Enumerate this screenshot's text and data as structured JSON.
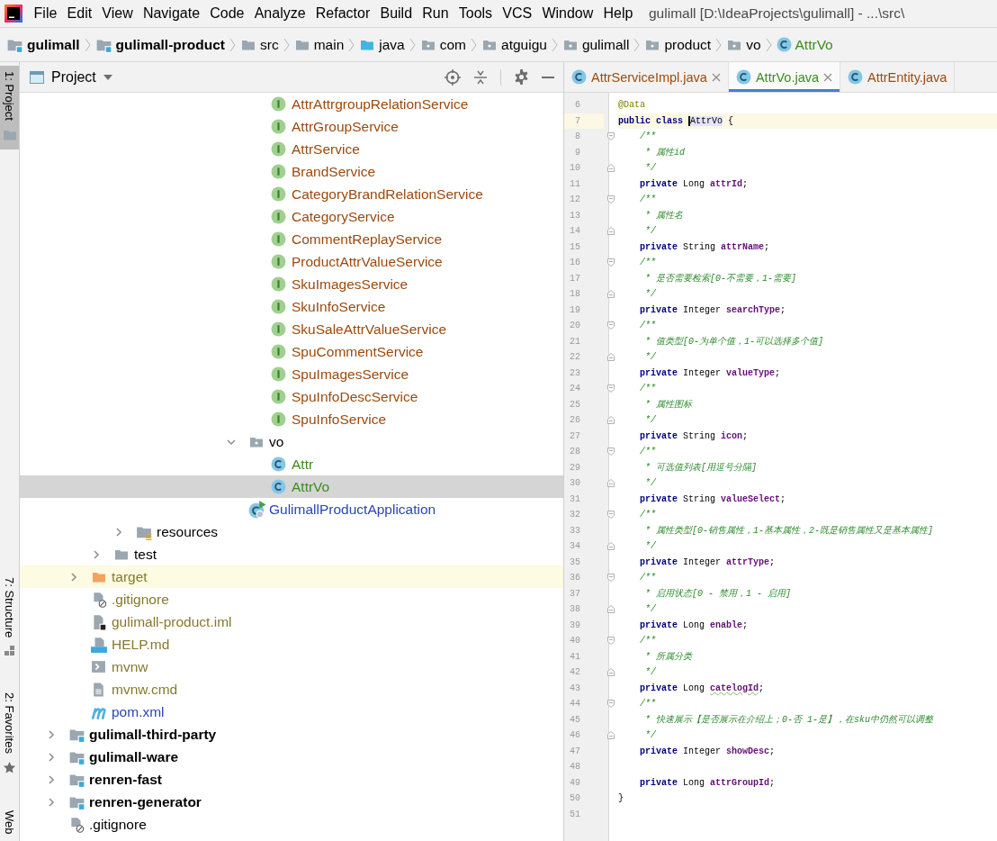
{
  "menu": {
    "items": [
      "File",
      "Edit",
      "View",
      "Navigate",
      "Code",
      "Analyze",
      "Refactor",
      "Build",
      "Run",
      "Tools",
      "VCS",
      "Window",
      "Help"
    ],
    "title": "gulimall [D:\\IdeaProjects\\gulimall] - ...\\src\\"
  },
  "breadcrumbs": [
    {
      "label": "gulimall",
      "kind": "module",
      "color": "#000000"
    },
    {
      "label": "gulimall-product",
      "kind": "module",
      "color": "#000000"
    },
    {
      "label": "src",
      "kind": "folder",
      "color": "#000000"
    },
    {
      "label": "main",
      "kind": "folder",
      "color": "#000000"
    },
    {
      "label": "java",
      "kind": "source-folder",
      "color": "#000000"
    },
    {
      "label": "com",
      "kind": "package",
      "color": "#000000"
    },
    {
      "label": "atguigu",
      "kind": "package",
      "color": "#000000"
    },
    {
      "label": "gulimall",
      "kind": "package",
      "color": "#000000"
    },
    {
      "label": "product",
      "kind": "package",
      "color": "#000000"
    },
    {
      "label": "vo",
      "kind": "package",
      "color": "#000000"
    },
    {
      "label": "AttrVo",
      "kind": "class",
      "color": "#3a8d1c"
    }
  ],
  "tool_strip": {
    "top": [
      {
        "label": "1: Project",
        "kind": "folder",
        "selected": true
      }
    ],
    "bottom": [
      {
        "label": "7: Structure",
        "kind": "structure",
        "selected": false
      },
      {
        "label": "2: Favorites",
        "kind": "star",
        "selected": false
      },
      {
        "label": "Web",
        "kind": "none",
        "selected": false
      }
    ]
  },
  "project": {
    "title": "Project",
    "tree": [
      {
        "children": [
          {
            "children": [
              {
                "children": [
                  {
                    "children": [
                      {
                        "children": [
                          {
                            "children": [
                              {
                                "children": [
                                  {
                                    "children": [
                                      {
                                        "children": [
                                          {
                                            "label": "AttrAttrgroupRelationService",
                                            "kind": "interface",
                                            "color": "#9c4a0f",
                                            "selected": false
                                          },
                                          {
                                            "label": "AttrGroupService",
                                            "kind": "interface",
                                            "color": "#9c4a0f",
                                            "selected": false
                                          },
                                          {
                                            "label": "AttrService",
                                            "kind": "interface",
                                            "color": "#9c4a0f",
                                            "selected": false
                                          },
                                          {
                                            "label": "BrandService",
                                            "kind": "interface",
                                            "color": "#9c4a0f",
                                            "selected": false
                                          },
                                          {
                                            "label": "CategoryBrandRelationService",
                                            "kind": "interface",
                                            "color": "#9c4a0f",
                                            "selected": false
                                          },
                                          {
                                            "label": "CategoryService",
                                            "kind": "interface",
                                            "color": "#9c4a0f",
                                            "selected": false
                                          },
                                          {
                                            "label": "CommentReplayService",
                                            "kind": "interface",
                                            "color": "#9c4a0f",
                                            "selected": false
                                          },
                                          {
                                            "label": "ProductAttrValueService",
                                            "kind": "interface",
                                            "color": "#9c4a0f",
                                            "selected": false
                                          },
                                          {
                                            "label": "SkuImagesService",
                                            "kind": "interface",
                                            "color": "#9c4a0f",
                                            "selected": false
                                          },
                                          {
                                            "label": "SkuInfoService",
                                            "kind": "interface",
                                            "color": "#9c4a0f",
                                            "selected": false
                                          },
                                          {
                                            "label": "SkuSaleAttrValueService",
                                            "kind": "interface",
                                            "color": "#9c4a0f",
                                            "selected": false
                                          },
                                          {
                                            "label": "SpuCommentService",
                                            "kind": "interface",
                                            "color": "#9c4a0f",
                                            "selected": false
                                          },
                                          {
                                            "label": "SpuImagesService",
                                            "kind": "interface",
                                            "color": "#9c4a0f",
                                            "selected": false
                                          },
                                          {
                                            "label": "SpuInfoDescService",
                                            "kind": "interface",
                                            "color": "#9c4a0f",
                                            "selected": false
                                          },
                                          {
                                            "label": "SpuInfoService",
                                            "kind": "interface",
                                            "color": "#9c4a0f",
                                            "selected": false
                                          }
                                        ]
                                      },
                                      {
                                        "label": "vo",
                                        "kind": "package",
                                        "color": "#000000",
                                        "selected": false,
                                        "expanded": true,
                                        "children": [
                                          {
                                            "label": "Attr",
                                            "kind": "class",
                                            "color": "#3a8d1c",
                                            "selected": false
                                          },
                                          {
                                            "label": "AttrVo",
                                            "kind": "class",
                                            "color": "#3a8d1c",
                                            "selected": true
                                          }
                                        ]
                                      },
                                      {
                                        "label": "GulimallProductApplication",
                                        "kind": "app-class",
                                        "color": "#2a46b8",
                                        "selected": false
                                      }
                                    ]
                                  }
                                ]
                              }
                            ]
                          }
                        ]
                      }
                    ]
                  },
                  {
                    "label": "resources",
                    "kind": "resources-folder",
                    "color": "#000000",
                    "selected": false,
                    "expanded": false
                  }
                ]
              },
              {
                "label": "test",
                "kind": "test-folder",
                "color": "#000000",
                "selected": false,
                "expanded": false
              }
            ]
          },
          {
            "label": "target",
            "kind": "excluded-folder",
            "color": "#86792f",
            "selected": false,
            "expanded": false
          },
          {
            "label": ".gitignore",
            "kind": "ignore-file",
            "color": "#86792f",
            "selected": false
          },
          {
            "label": "gulimall-product.iml",
            "kind": "module-file",
            "color": "#86792f",
            "selected": false
          },
          {
            "label": "HELP.md",
            "kind": "markdown-file",
            "color": "#86792f",
            "selected": false
          },
          {
            "label": "mvnw",
            "kind": "script-file",
            "color": "#86792f",
            "selected": false
          },
          {
            "label": "mvnw.cmd",
            "kind": "text-file",
            "color": "#86792f",
            "selected": false
          },
          {
            "label": "pom.xml",
            "kind": "maven-file",
            "color": "#2a46b8",
            "selected": false
          }
        ]
      },
      {
        "label": "gulimall-third-party",
        "kind": "module",
        "color": "#000000",
        "selected": false,
        "expanded": false
      },
      {
        "label": "gulimall-ware",
        "kind": "module",
        "color": "#000000",
        "selected": false,
        "expanded": false
      },
      {
        "label": "renren-fast",
        "kind": "module",
        "color": "#000000",
        "selected": false,
        "expanded": false
      },
      {
        "label": "renren-generator",
        "kind": "module",
        "color": "#000000",
        "selected": false,
        "expanded": false
      },
      {
        "label": ".gitignore",
        "kind": "ignore-file",
        "color": "#000000",
        "selected": false
      }
    ]
  },
  "editor": {
    "tabs": [
      {
        "label": "AttrServiceImpl.java",
        "color": "#9c4a0f",
        "selected": false
      },
      {
        "label": "AttrVo.java",
        "color": "#3a8d1c",
        "selected": true
      },
      {
        "label": "AttrEntity.java",
        "color": "#9c4a0f",
        "selected": false
      }
    ],
    "lines": [
      {
        "number": "6",
        "current": false,
        "kind": "code",
        "spans": [
          {
            "kind": "annotation",
            "text": "@Data"
          }
        ]
      },
      {
        "number": "7",
        "current": true,
        "kind": "code",
        "spans": [
          {
            "kind": "keyword",
            "text": "public class "
          },
          {
            "kind": "caret-identifier",
            "text": "AttrVo"
          },
          {
            "kind": "plain",
            "text": " {"
          }
        ]
      },
      {
        "number": "8",
        "current": false,
        "kind": "fold-start",
        "spans": [
          {
            "kind": "comment",
            "text": "    /**"
          }
        ]
      },
      {
        "number": "9",
        "current": false,
        "kind": "code",
        "spans": [
          {
            "kind": "comment",
            "text": "     * 属性id"
          }
        ]
      },
      {
        "number": "10",
        "current": false,
        "kind": "fold-end",
        "spans": [
          {
            "kind": "comment",
            "text": "     */"
          }
        ]
      },
      {
        "number": "11",
        "current": false,
        "kind": "code",
        "spans": [
          {
            "kind": "keyword",
            "text": "    private "
          },
          {
            "kind": "plain",
            "text": "Long "
          },
          {
            "kind": "field",
            "text": "attrId"
          },
          {
            "kind": "plain",
            "text": ";"
          }
        ]
      },
      {
        "number": "12",
        "current": false,
        "kind": "fold-start",
        "spans": [
          {
            "kind": "comment",
            "text": "    /**"
          }
        ]
      },
      {
        "number": "13",
        "current": false,
        "kind": "code",
        "spans": [
          {
            "kind": "comment",
            "text": "     * 属性名"
          }
        ]
      },
      {
        "number": "14",
        "current": false,
        "kind": "fold-end",
        "spans": [
          {
            "kind": "comment",
            "text": "     */"
          }
        ]
      },
      {
        "number": "15",
        "current": false,
        "kind": "code",
        "spans": [
          {
            "kind": "keyword",
            "text": "    private "
          },
          {
            "kind": "plain",
            "text": "String "
          },
          {
            "kind": "field",
            "text": "attrName"
          },
          {
            "kind": "plain",
            "text": ";"
          }
        ]
      },
      {
        "number": "16",
        "current": false,
        "kind": "fold-start",
        "spans": [
          {
            "kind": "comment",
            "text": "    /**"
          }
        ]
      },
      {
        "number": "17",
        "current": false,
        "kind": "code",
        "spans": [
          {
            "kind": "comment",
            "text": "     * 是否需要检索[0-不需要，1-需要]"
          }
        ]
      },
      {
        "number": "18",
        "current": false,
        "kind": "fold-end",
        "spans": [
          {
            "kind": "comment",
            "text": "     */"
          }
        ]
      },
      {
        "number": "19",
        "current": false,
        "kind": "code",
        "spans": [
          {
            "kind": "keyword",
            "text": "    private "
          },
          {
            "kind": "plain",
            "text": "Integer "
          },
          {
            "kind": "field",
            "text": "searchType"
          },
          {
            "kind": "plain",
            "text": ";"
          }
        ]
      },
      {
        "number": "20",
        "current": false,
        "kind": "fold-start",
        "spans": [
          {
            "kind": "comment",
            "text": "    /**"
          }
        ]
      },
      {
        "number": "21",
        "current": false,
        "kind": "code",
        "spans": [
          {
            "kind": "comment",
            "text": "     * 值类型[0-为单个值，1-可以选择多个值]"
          }
        ]
      },
      {
        "number": "22",
        "current": false,
        "kind": "fold-end",
        "spans": [
          {
            "kind": "comment",
            "text": "     */"
          }
        ]
      },
      {
        "number": "23",
        "current": false,
        "kind": "code",
        "spans": [
          {
            "kind": "keyword",
            "text": "    private "
          },
          {
            "kind": "plain",
            "text": "Integer "
          },
          {
            "kind": "field",
            "text": "valueType"
          },
          {
            "kind": "plain",
            "text": ";"
          }
        ]
      },
      {
        "number": "24",
        "current": false,
        "kind": "fold-start",
        "spans": [
          {
            "kind": "comment",
            "text": "    /**"
          }
        ]
      },
      {
        "number": "25",
        "current": false,
        "kind": "code",
        "spans": [
          {
            "kind": "comment",
            "text": "     * 属性图标"
          }
        ]
      },
      {
        "number": "26",
        "current": false,
        "kind": "fold-end",
        "spans": [
          {
            "kind": "comment",
            "text": "     */"
          }
        ]
      },
      {
        "number": "27",
        "current": false,
        "kind": "code",
        "spans": [
          {
            "kind": "keyword",
            "text": "    private "
          },
          {
            "kind": "plain",
            "text": "String "
          },
          {
            "kind": "field",
            "text": "icon"
          },
          {
            "kind": "plain",
            "text": ";"
          }
        ]
      },
      {
        "number": "28",
        "current": false,
        "kind": "fold-start",
        "spans": [
          {
            "kind": "comment",
            "text": "    /**"
          }
        ]
      },
      {
        "number": "29",
        "current": false,
        "kind": "code",
        "spans": [
          {
            "kind": "comment",
            "text": "     * 可选值列表[用逗号分隔]"
          }
        ]
      },
      {
        "number": "30",
        "current": false,
        "kind": "fold-end",
        "spans": [
          {
            "kind": "comment",
            "text": "     */"
          }
        ]
      },
      {
        "number": "31",
        "current": false,
        "kind": "code",
        "spans": [
          {
            "kind": "keyword",
            "text": "    private "
          },
          {
            "kind": "plain",
            "text": "String "
          },
          {
            "kind": "field",
            "text": "valueSelect"
          },
          {
            "kind": "plain",
            "text": ";"
          }
        ]
      },
      {
        "number": "32",
        "current": false,
        "kind": "fold-start",
        "spans": [
          {
            "kind": "comment",
            "text": "    /**"
          }
        ]
      },
      {
        "number": "33",
        "current": false,
        "kind": "code",
        "spans": [
          {
            "kind": "comment",
            "text": "     * 属性类型[0-销售属性，1-基本属性，2-既是销售属性又是基本属性]"
          }
        ]
      },
      {
        "number": "34",
        "current": false,
        "kind": "fold-end",
        "spans": [
          {
            "kind": "comment",
            "text": "     */"
          }
        ]
      },
      {
        "number": "35",
        "current": false,
        "kind": "code",
        "spans": [
          {
            "kind": "keyword",
            "text": "    private "
          },
          {
            "kind": "plain",
            "text": "Integer "
          },
          {
            "kind": "field",
            "text": "attrType"
          },
          {
            "kind": "plain",
            "text": ";"
          }
        ]
      },
      {
        "number": "36",
        "current": false,
        "kind": "fold-start",
        "spans": [
          {
            "kind": "comment",
            "text": "    /**"
          }
        ]
      },
      {
        "number": "37",
        "current": false,
        "kind": "code",
        "spans": [
          {
            "kind": "comment",
            "text": "     * 启用状态[0 - 禁用，1 - 启用]"
          }
        ]
      },
      {
        "number": "38",
        "current": false,
        "kind": "fold-end",
        "spans": [
          {
            "kind": "comment",
            "text": "     */"
          }
        ]
      },
      {
        "number": "39",
        "current": false,
        "kind": "code",
        "spans": [
          {
            "kind": "keyword",
            "text": "    private "
          },
          {
            "kind": "plain",
            "text": "Long "
          },
          {
            "kind": "field",
            "text": "enable"
          },
          {
            "kind": "plain",
            "text": ";"
          }
        ]
      },
      {
        "number": "40",
        "current": false,
        "kind": "fold-start",
        "spans": [
          {
            "kind": "comment",
            "text": "    /**"
          }
        ]
      },
      {
        "number": "41",
        "current": false,
        "kind": "code",
        "spans": [
          {
            "kind": "comment",
            "text": "     * 所属分类"
          }
        ]
      },
      {
        "number": "42",
        "current": false,
        "kind": "fold-end",
        "spans": [
          {
            "kind": "comment",
            "text": "     */"
          }
        ]
      },
      {
        "number": "43",
        "current": false,
        "kind": "code",
        "spans": [
          {
            "kind": "keyword",
            "text": "    private "
          },
          {
            "kind": "plain",
            "text": "Long "
          },
          {
            "kind": "field-typo",
            "text": "catelogId"
          },
          {
            "kind": "plain",
            "text": ";"
          }
        ]
      },
      {
        "number": "44",
        "current": false,
        "kind": "fold-start",
        "spans": [
          {
            "kind": "comment",
            "text": "    /**"
          }
        ]
      },
      {
        "number": "45",
        "current": false,
        "kind": "code",
        "spans": [
          {
            "kind": "comment",
            "text": "     * 快速展示【是否展示在介绍上；0-否 1-是】，在sku中仍然可以调整"
          }
        ]
      },
      {
        "number": "46",
        "current": false,
        "kind": "fold-end",
        "spans": [
          {
            "kind": "comment",
            "text": "     */"
          }
        ]
      },
      {
        "number": "47",
        "current": false,
        "kind": "code",
        "spans": [
          {
            "kind": "keyword",
            "text": "    private "
          },
          {
            "kind": "plain",
            "text": "Integer "
          },
          {
            "kind": "field",
            "text": "showDesc"
          },
          {
            "kind": "plain",
            "text": ";"
          }
        ]
      },
      {
        "number": "48",
        "current": false,
        "kind": "code"
      },
      {
        "number": "49",
        "current": false,
        "kind": "code",
        "spans": [
          {
            "kind": "keyword",
            "text": "    private "
          },
          {
            "kind": "plain",
            "text": "Long "
          },
          {
            "kind": "field",
            "text": "attrGroupId"
          },
          {
            "kind": "plain",
            "text": ";"
          }
        ]
      },
      {
        "number": "50",
        "current": false,
        "kind": "code",
        "spans": [
          {
            "kind": "plain",
            "text": "}"
          }
        ]
      },
      {
        "number": "51",
        "current": false,
        "kind": "code"
      }
    ]
  }
}
